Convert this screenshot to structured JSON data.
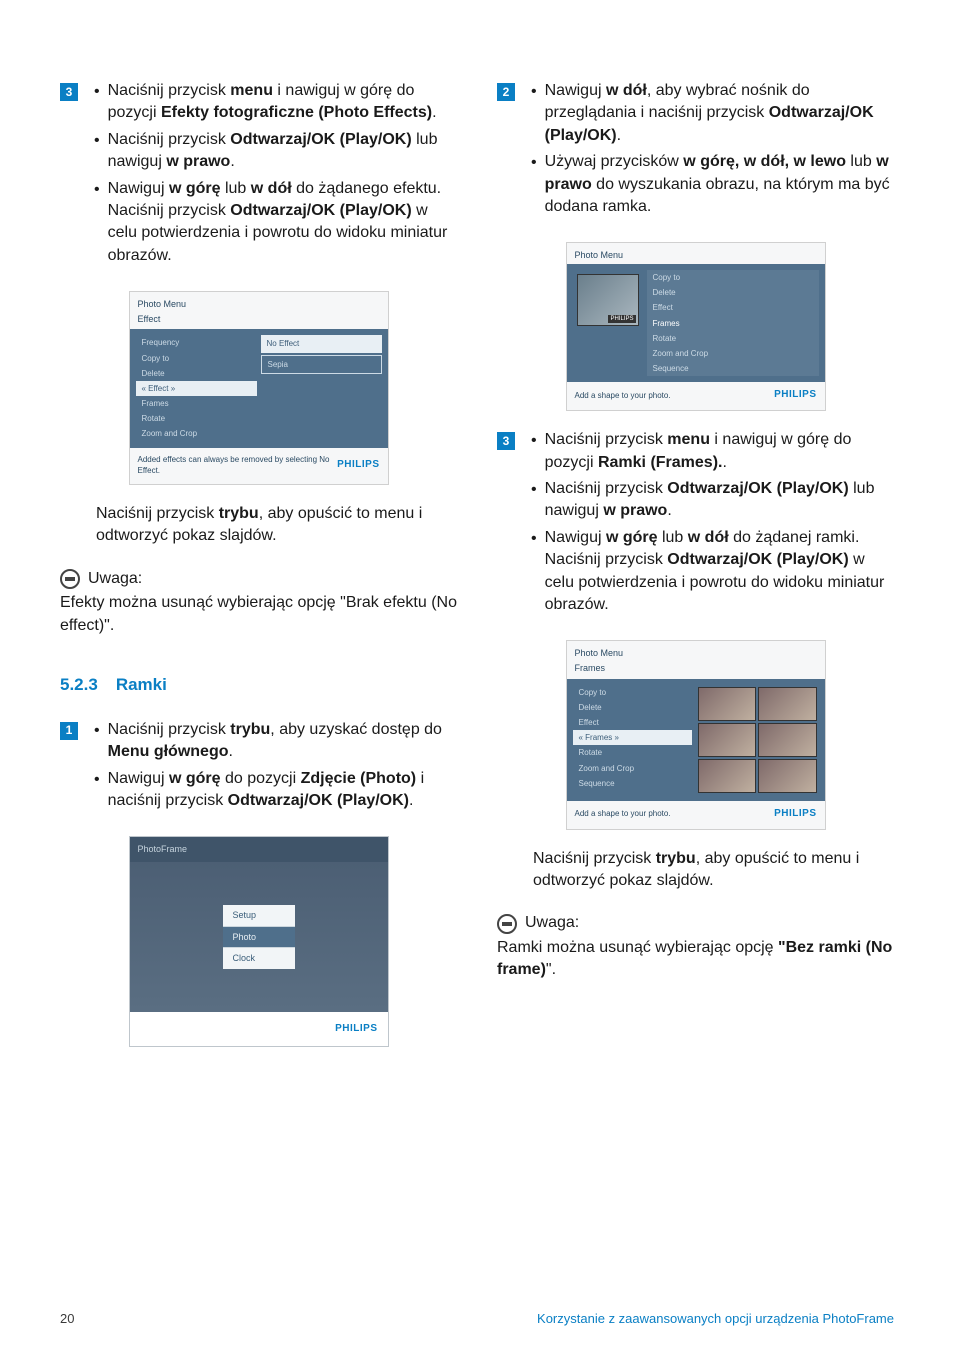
{
  "left": {
    "step3": {
      "b1_a": "Naciśnij przycisk ",
      "b1_b": "menu",
      "b1_c": " i nawiguj w górę do pozycji ",
      "b1_d": "Efekty fotograficzne (Photo Effects)",
      "b1_e": ".",
      "b2_a": "Naciśnij przycisk ",
      "b2_b": "Odtwarzaj/OK (Play/OK)",
      "b2_c": " lub nawiguj ",
      "b2_d": "w prawo",
      "b2_e": ".",
      "b3_a": "Nawiguj ",
      "b3_b": "w górę",
      "b3_c": " lub ",
      "b3_d": "w dół",
      "b3_e": " do żądanego efektu. Naciśnij przycisk ",
      "b3_f": "Odtwarzaj/OK (Play/OK)",
      "b3_g": " w celu potwierdzenia i powrotu do widoku miniatur obrazów."
    },
    "shot1": {
      "hdr": "Photo Menu",
      "sub": "Effect",
      "list": [
        "Frequency",
        "Copy to",
        "Delete",
        "« Effect »",
        "Frames",
        "Rotate",
        "Zoom and Crop"
      ],
      "right": [
        "No Effect",
        "Sepia"
      ],
      "ftr": "Added effects can always be removed by selecting No Effect.",
      "brand": "PHILIPS"
    },
    "after3_a": "Naciśnij przycisk ",
    "after3_b": "trybu",
    "after3_c": ", aby opuścić to menu i odtworzyć pokaz slajdów.",
    "note_label": "Uwaga:",
    "note_body": "Efekty można usunąć wybierając opcję \"Brak efektu (No effect)\".",
    "heading_num": "5.2.3",
    "heading_text": "Ramki",
    "step1": {
      "b1_a": "Naciśnij przycisk ",
      "b1_b": "trybu",
      "b1_c": ", aby uzyskać dostęp do ",
      "b1_d": "Menu głównego",
      "b1_e": ".",
      "b2_a": "Nawiguj ",
      "b2_b": "w górę",
      "b2_c": " do pozycji ",
      "b2_d": "Zdjęcie (Photo)",
      "b2_e": " i naciśnij przycisk ",
      "b2_f": "Odtwarzaj/OK (Play/OK)",
      "b2_g": "."
    },
    "shot2": {
      "hdr": "PhotoFrame",
      "menu": [
        "Setup",
        "Photo",
        "Clock"
      ],
      "brand": "PHILIPS"
    }
  },
  "right": {
    "step2": {
      "b1_a": "Nawiguj ",
      "b1_b": "w dół",
      "b1_c": ", aby wybrać nośnik do przeglądania i naciśnij przycisk ",
      "b1_d": "Odtwarzaj/OK (Play/OK)",
      "b1_e": ".",
      "b2_a": "Używaj przycisków ",
      "b2_b": "w górę, w dół, w lewo",
      "b2_c": " lub ",
      "b2_d": "w prawo",
      "b2_e": " do wyszukania obrazu, na którym ma być dodana ramka."
    },
    "shot3": {
      "hdr": "Photo Menu",
      "list": [
        "Copy to",
        "Delete",
        "Effect",
        "Frames",
        "Rotate",
        "Zoom and Crop",
        "Sequence"
      ],
      "thumb_tag": "PHILIPS",
      "ftr": "Add a shape to your photo.",
      "brand": "PHILIPS"
    },
    "step3": {
      "b1_a": "Naciśnij przycisk ",
      "b1_b": "menu",
      "b1_c": " i nawiguj w górę do pozycji ",
      "b1_d": "Ramki (Frames).",
      "b1_e": ".",
      "b2_a": "Naciśnij przycisk ",
      "b2_b": "Odtwarzaj/OK (Play/OK)",
      "b2_c": " lub nawiguj ",
      "b2_d": "w prawo",
      "b2_e": ".",
      "b3_a": "Nawiguj ",
      "b3_b": "w górę",
      "b3_c": " lub ",
      "b3_d": "w dół",
      "b3_e": " do żądanej ramki. Naciśnij przycisk ",
      "b3_f": "Odtwarzaj/OK (Play/OK)",
      "b3_g": " w celu potwierdzenia i powrotu do widoku miniatur obrazów."
    },
    "shot4": {
      "hdr": "Photo Menu",
      "sub": "Frames",
      "list": [
        "Copy to",
        "Delete",
        "Effect",
        "« Frames »",
        "Rotate",
        "Zoom and Crop",
        "Sequence"
      ],
      "ftr": "Add a shape to your photo.",
      "brand": "PHILIPS"
    },
    "after3_a": "Naciśnij przycisk ",
    "after3_b": "trybu",
    "after3_c": ", aby opuścić to menu i odtworzyć pokaz slajdów.",
    "note_label": "Uwaga:",
    "note1": "Ramki można usunąć wybierając opcję ",
    "note2": "\"Bez ramki (No frame)",
    "note3": "\"."
  },
  "footer": {
    "page": "20",
    "text": "Korzystanie z zaawansowanych opcji urządzenia PhotoFrame"
  }
}
